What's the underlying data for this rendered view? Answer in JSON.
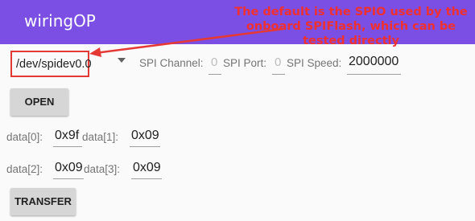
{
  "appbar": {
    "title": "wiringOP"
  },
  "annotation": {
    "text": "The default is the SPIO used by the onboard SPIFlash, which can be tested directly",
    "color": "#f03030"
  },
  "spi": {
    "device": "/dev/spidev0.0",
    "channel_label": "SPI Channel:",
    "channel_value": "0",
    "port_label": "SPI Port:",
    "port_value": "0",
    "speed_label": "SPI Speed:",
    "speed_value": "2000000"
  },
  "buttons": {
    "open": "OPEN",
    "transfer": "TRANSFER"
  },
  "data_fields": [
    {
      "label": "data[0]:",
      "value": "0x9f"
    },
    {
      "label": "data[1]:",
      "value": "0x09"
    },
    {
      "label": "data[2]:",
      "value": "0x09"
    },
    {
      "label": "data[3]:",
      "value": "0x09"
    }
  ],
  "colors": {
    "appbar": "#7b4fe3",
    "highlight_box": "#e53935"
  }
}
